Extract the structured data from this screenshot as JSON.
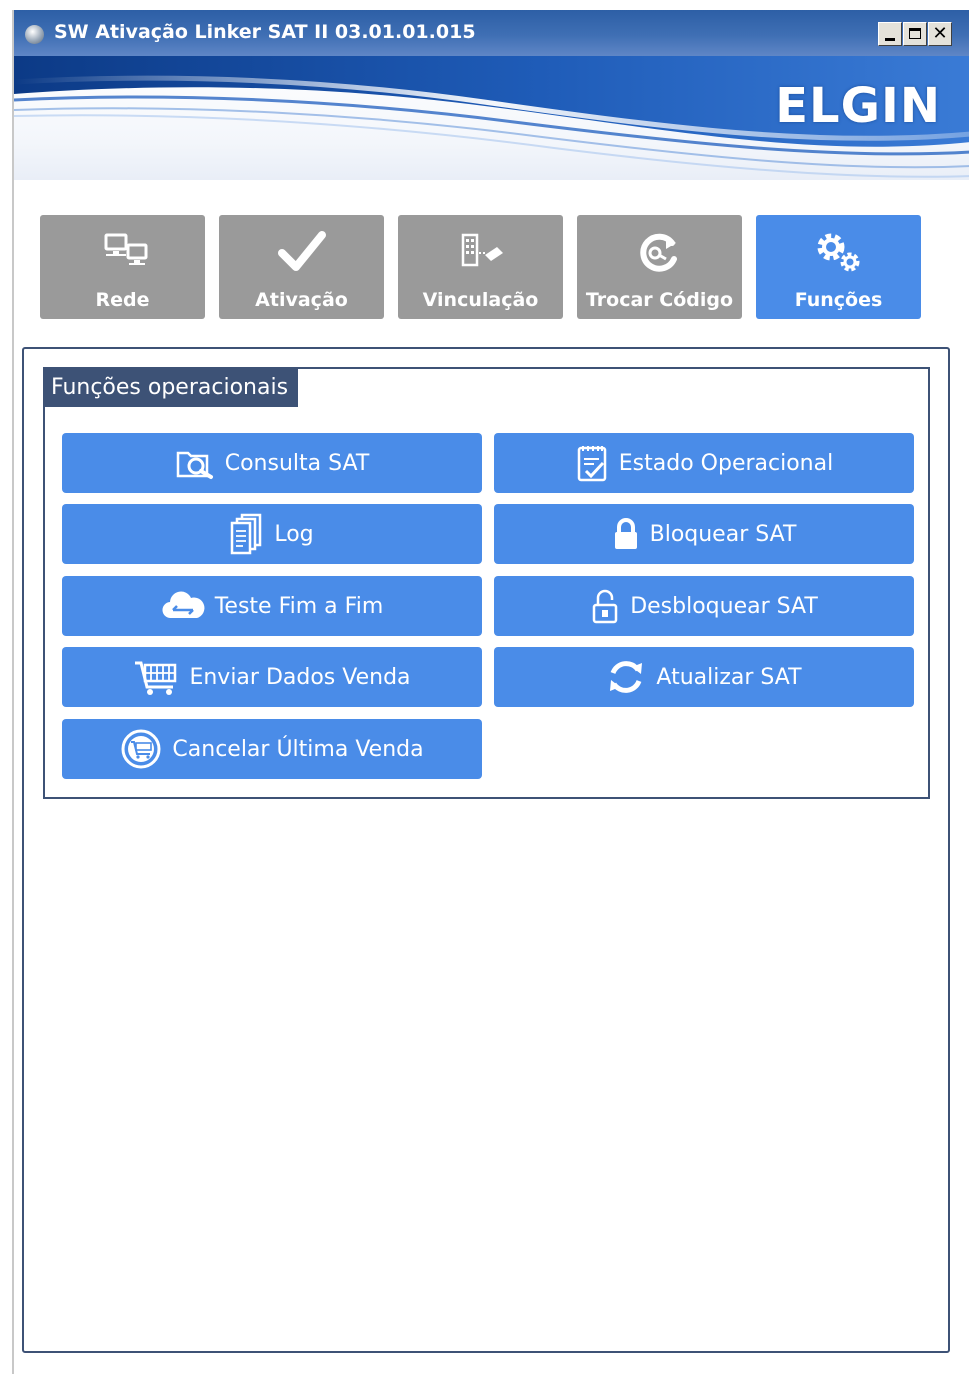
{
  "window": {
    "title": "SW Ativação Linker SAT II 03.01.01.015",
    "brand": "ELGIN"
  },
  "tabs": [
    {
      "label": "Rede",
      "icon": "network-icon",
      "active": false
    },
    {
      "label": "Ativação",
      "icon": "checkmark-icon",
      "active": false
    },
    {
      "label": "Vinculação",
      "icon": "building-link-icon",
      "active": false
    },
    {
      "label": "Trocar Código",
      "icon": "refresh-key-icon",
      "active": false
    },
    {
      "label": "Funções",
      "icon": "gears-icon",
      "active": true
    }
  ],
  "group": {
    "title": "Funções operacionais"
  },
  "buttons": {
    "consulta_sat": {
      "label": "Consulta SAT",
      "icon": "folder-search-icon"
    },
    "estado_operacional": {
      "label": "Estado Operacional",
      "icon": "clipboard-check-icon"
    },
    "log": {
      "label": "Log",
      "icon": "documents-icon"
    },
    "bloquear_sat": {
      "label": "Bloquear SAT",
      "icon": "lock-icon"
    },
    "teste_fim_a_fim": {
      "label": "Teste Fim a Fim",
      "icon": "cloud-transfer-icon"
    },
    "desbloquear_sat": {
      "label": "Desbloquear SAT",
      "icon": "unlock-icon"
    },
    "enviar_dados_venda": {
      "label": "Enviar Dados Venda",
      "icon": "shopping-cart-icon"
    },
    "atualizar_sat": {
      "label": "Atualizar SAT",
      "icon": "refresh-icon"
    },
    "cancelar_ultima_venda": {
      "label": "Cancelar Última Venda",
      "icon": "cancel-cart-icon"
    }
  },
  "colors": {
    "accent": "#4a8ce8",
    "tab_inactive": "#9a9a9a",
    "panel_border": "#3d5276",
    "titlebar": "#3a69ae"
  }
}
